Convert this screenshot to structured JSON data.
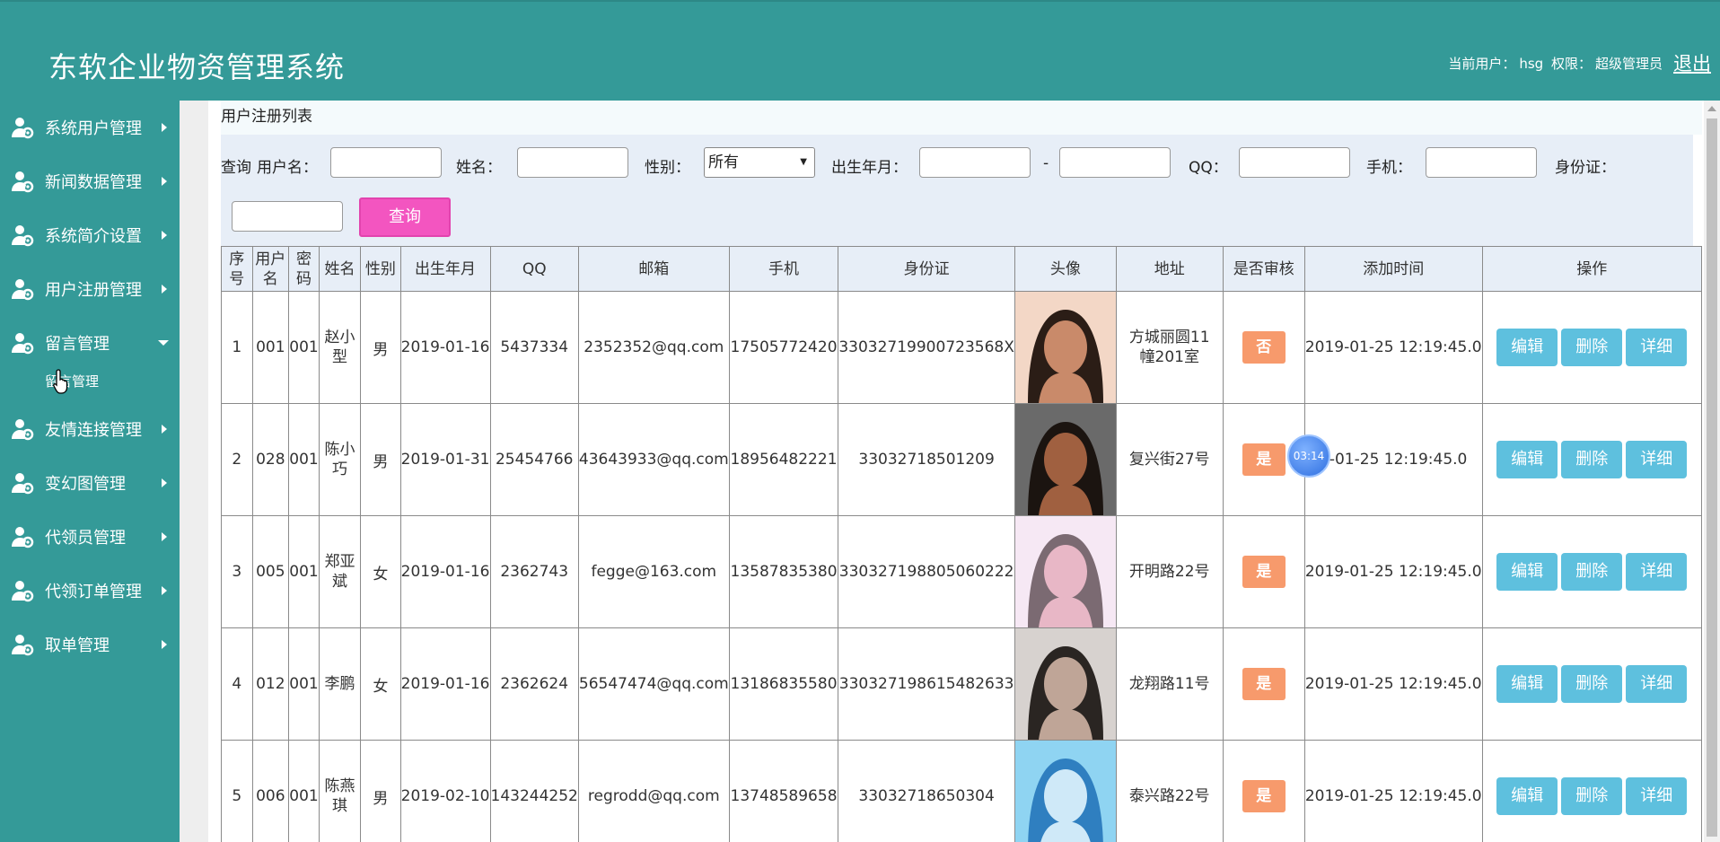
{
  "header": {
    "title": "东软企业物资管理系统",
    "current_user_label": "当前用户：",
    "current_user": "hsg",
    "role_label": "权限：",
    "role": "超级管理员",
    "logout": "退出"
  },
  "sidebar": {
    "items": [
      {
        "label": "系统用户管理"
      },
      {
        "label": "新闻数据管理"
      },
      {
        "label": "系统简介设置"
      },
      {
        "label": "用户注册管理"
      },
      {
        "label": "留言管理"
      },
      {
        "label": "友情连接管理"
      },
      {
        "label": "变幻图管理"
      },
      {
        "label": "代领员管理"
      },
      {
        "label": "代领订单管理"
      },
      {
        "label": "取单管理"
      }
    ],
    "sub_item": "留言管理"
  },
  "panel": {
    "title": "用户注册列表"
  },
  "filter": {
    "query_label": "查询",
    "username_label": "用户名：",
    "name_label": "姓名：",
    "gender_label": "性别：",
    "gender_value": "所有",
    "birth_label": "出生年月：",
    "range_sep": "-",
    "qq_label": "QQ：",
    "phone_label": "手机：",
    "idcard_label": "身份证：",
    "query_button": "查询"
  },
  "table": {
    "headers": [
      "序号",
      "用户名",
      "密码",
      "姓名",
      "性别",
      "出生年月",
      "QQ",
      "邮箱",
      "手机",
      "身份证",
      "头像",
      "地址",
      "是否审核",
      "添加时间",
      "操作"
    ],
    "rows": [
      {
        "no": "1",
        "username": "001",
        "password": "001",
        "name": "赵小型",
        "gender": "男",
        "birth": "2019-01-16",
        "qq": "5437334",
        "email": "2352352@qq.com",
        "phone": "17505772420",
        "idcard": "33032719900723568X",
        "address": "方城丽圆11幢201室",
        "audit": "否",
        "time": "2019-01-25 12:19:45.0"
      },
      {
        "no": "2",
        "username": "028",
        "password": "001",
        "name": "陈小巧",
        "gender": "男",
        "birth": "2019-01-31",
        "qq": "25454766",
        "email": "43643933@qq.com",
        "phone": "18956482221",
        "idcard": "33032718501209",
        "address": "复兴街27号",
        "audit": "是",
        "time": "9-01-25 12:19:45.0"
      },
      {
        "no": "3",
        "username": "005",
        "password": "001",
        "name": "郑亚斌",
        "gender": "女",
        "birth": "2019-01-16",
        "qq": "2362743",
        "email": "fegge@163.com",
        "phone": "13587835380",
        "idcard": "330327198805060222",
        "address": "开明路22号",
        "audit": "是",
        "time": "2019-01-25 12:19:45.0"
      },
      {
        "no": "4",
        "username": "012",
        "password": "001",
        "name": "李鹏",
        "gender": "女",
        "birth": "2019-01-16",
        "qq": "2362624",
        "email": "56547474@qq.com",
        "phone": "13186835580",
        "idcard": "330327198615482633",
        "address": "龙翔路11号",
        "audit": "是",
        "time": "2019-01-25 12:19:45.0"
      },
      {
        "no": "5",
        "username": "006",
        "password": "001",
        "name": "陈燕琪",
        "gender": "男",
        "birth": "2019-02-10",
        "qq": "143244252",
        "email": "regrodd@qq.com",
        "phone": "13748589658",
        "idcard": "33032718650304",
        "address": "泰兴路22号",
        "audit": "是",
        "time": "2019-01-25 12:19:45.0"
      }
    ],
    "actions": {
      "edit": "编辑",
      "delete": "删除",
      "detail": "详细"
    }
  },
  "overlay": {
    "timer": "03:14"
  },
  "colors": {
    "primary": "#349a98",
    "badge": "#f79a6c",
    "action": "#5ec0de",
    "query": "#f355c0"
  }
}
